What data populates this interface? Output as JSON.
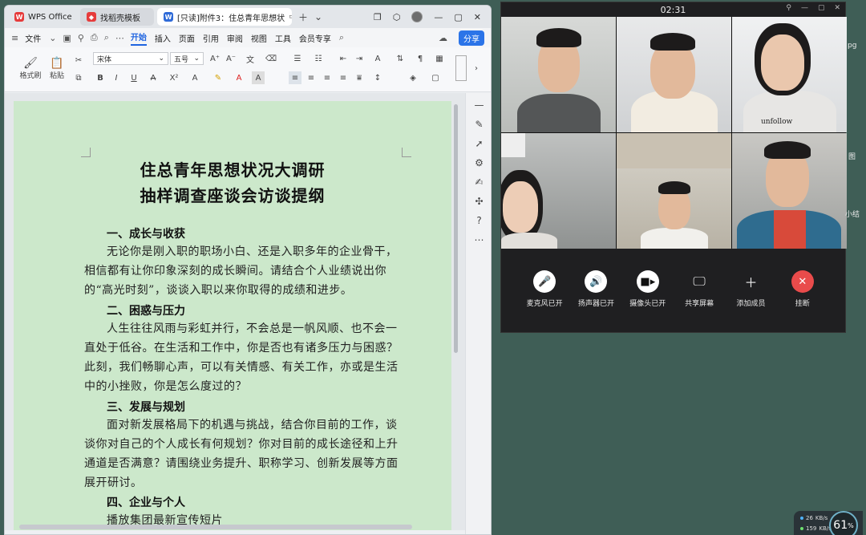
{
  "wps": {
    "tabs": [
      {
        "label": "WPS Office",
        "logo": "W"
      },
      {
        "label": "找稻壳模板",
        "logo": ""
      },
      {
        "label": "[只读]附件3：住总青年思想状",
        "logo": "W"
      }
    ],
    "menu": {
      "file": "文件",
      "items": [
        "开始",
        "插入",
        "页面",
        "引用",
        "审阅",
        "视图",
        "工具",
        "会员专享"
      ],
      "share": "分享"
    },
    "ribbon": {
      "format_painter": "格式刷",
      "paste": "粘贴",
      "font_name": "宋体",
      "font_size": "五号"
    },
    "document": {
      "title_line1": "住总青年思想状况大调研",
      "title_line2": "抽样调查座谈会访谈提纲",
      "sections": [
        {
          "heading": "一、成长与收获",
          "body": "无论你是刚入职的职场小白、还是入职多年的企业骨干，相信都有让你印象深刻的成长瞬间。请结合个人业绩说出你的“高光时刻”，谈谈入职以来你取得的成绩和进步。"
        },
        {
          "heading": "二、困惑与压力",
          "body": "人生往往风雨与彩虹并行，不会总是一帆风顺、也不会一直处于低谷。在生活和工作中，你是否也有诸多压力与困惑？此刻，我们畅聊心声，可以有关情感、有关工作，亦或是生活中的小挫败，你是怎么度过的？"
        },
        {
          "heading": "三、发展与规划",
          "body": "面对新发展格局下的机遇与挑战，结合你目前的工作，谈谈你对自己的个人成长有何规划？你对目前的成长途径和上升通道是否满意？请围绕业务提升、职称学习、创新发展等方面展开研讨。"
        },
        {
          "heading": "四、企业与个人",
          "body": "播放集团最新宣传短片"
        }
      ]
    }
  },
  "video_call": {
    "timer": "02:31",
    "controls": [
      {
        "label": "麦克风已开",
        "icon": "microphone-icon"
      },
      {
        "label": "扬声器已开",
        "icon": "speaker-icon"
      },
      {
        "label": "摄像头已开",
        "icon": "camera-icon"
      },
      {
        "label": "共享屏幕",
        "icon": "screen-share-icon"
      },
      {
        "label": "添加成员",
        "icon": "plus-icon"
      },
      {
        "label": "挂断",
        "icon": "hangup-icon"
      }
    ],
    "shirt_text": "unfollow"
  },
  "desktop": {
    "upload": "26",
    "download": "159",
    "upload_unit": "KB/s",
    "download_unit": "KB/s",
    "percent": "61",
    "percent_sign": "%",
    "edge_labels": [
      "pg",
      "图",
      "小结"
    ]
  }
}
